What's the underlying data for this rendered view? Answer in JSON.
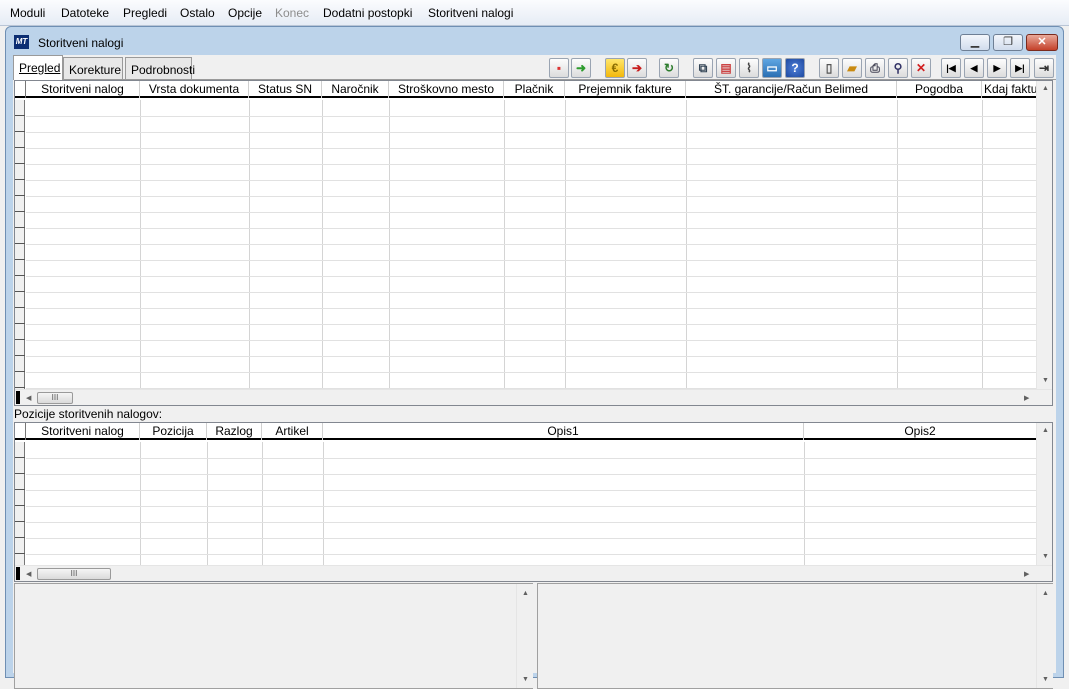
{
  "menu": {
    "items": [
      {
        "label": "Moduli"
      },
      {
        "label": "Datoteke"
      },
      {
        "label": "Pregledi"
      },
      {
        "label": "Ostalo"
      },
      {
        "label": "Opcije"
      },
      {
        "label": "Konec",
        "disabled": true
      },
      {
        "label": "Dodatni postopki"
      },
      {
        "label": "Storitveni nalogi"
      }
    ]
  },
  "window": {
    "title": "Storitveni nalogi",
    "icon_text": "MT",
    "controls": [
      "minimize-icon",
      "restore-icon",
      "close-icon"
    ]
  },
  "tabs": [
    {
      "label": "Pregled",
      "active": true
    },
    {
      "label": "Korekture"
    },
    {
      "label": "Podrobnosti"
    }
  ],
  "toolbar": {
    "buttons": [
      {
        "icon": "import-icon"
      },
      {
        "icon": "arrow-right-green-icon"
      },
      {
        "icon": "euro-icon"
      },
      {
        "icon": "arrow-right-red-icon"
      },
      {
        "icon": "refresh-icon"
      },
      {
        "icon": "copy-documents-icon"
      },
      {
        "icon": "form-icon"
      },
      {
        "icon": "attachment-icon"
      },
      {
        "icon": "monitor-icon"
      },
      {
        "icon": "help-icon"
      },
      {
        "icon": "new-document-icon"
      },
      {
        "icon": "open-folder-icon"
      },
      {
        "icon": "print-icon"
      },
      {
        "icon": "search-icon"
      },
      {
        "icon": "delete-icon"
      },
      {
        "icon": "first-record-icon"
      },
      {
        "icon": "previous-record-icon"
      },
      {
        "icon": "next-record-icon"
      },
      {
        "icon": "last-record-icon"
      },
      {
        "icon": "exit-icon"
      }
    ],
    "accent_green": "#2e9c2e",
    "accent_red": "#c81e1e"
  },
  "main_grid": {
    "columns": [
      "Storitveni nalog",
      "Vrsta dokumenta",
      "Status SN",
      "Naročnik",
      "Stroškovno mesto",
      "Plačnik",
      "Prejemnik fakture",
      "ŠT. garancije/Račun Belimed",
      "Pogodba",
      "Kdaj fakturo"
    ],
    "rows": []
  },
  "positions_label": "Pozicije storitvenih nalogov:",
  "positions_grid": {
    "columns": [
      "Storitveni nalog",
      "Pozicija",
      "Razlog",
      "Artikel",
      "Opis1",
      "Opis2"
    ],
    "rows": []
  },
  "scroll_thumb_text": "III"
}
